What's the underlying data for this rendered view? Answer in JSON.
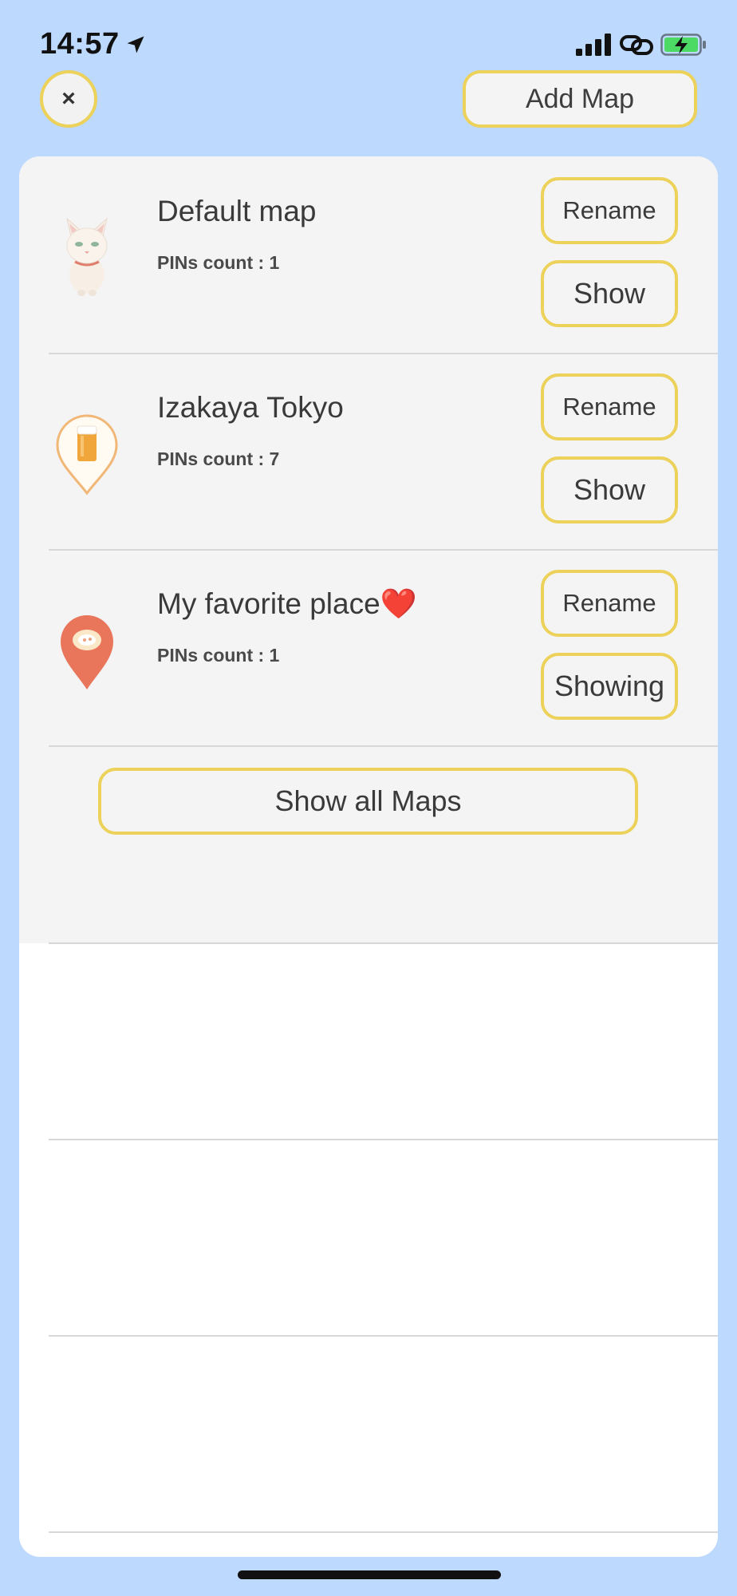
{
  "status_bar": {
    "time": "14:57",
    "icons": [
      "location-arrow-icon",
      "cellular-signal-icon",
      "link-icon",
      "battery-charging-icon"
    ]
  },
  "header": {
    "close_label": "×",
    "add_map_label": "Add Map"
  },
  "maps": [
    {
      "name": "Default map",
      "pins": "PINs count : 1",
      "icon": "cat-icon",
      "rename_label": "Rename",
      "show_label": "Show"
    },
    {
      "name": "Izakaya Tokyo",
      "pins": "PINs count : 7",
      "icon": "beer-pin-icon",
      "rename_label": "Rename",
      "show_label": "Show"
    },
    {
      "name": "My favorite place❤️",
      "pins": "PINs count : 1",
      "icon": "red-pin-icon",
      "rename_label": "Rename",
      "show_label": "Showing"
    }
  ],
  "footer": {
    "show_all_label": "Show all Maps"
  },
  "colors": {
    "background": "#bdd9fe",
    "button_border": "#ecd15a",
    "sheet_gray": "#f4f4f4",
    "battery_green": "#4cd964"
  }
}
